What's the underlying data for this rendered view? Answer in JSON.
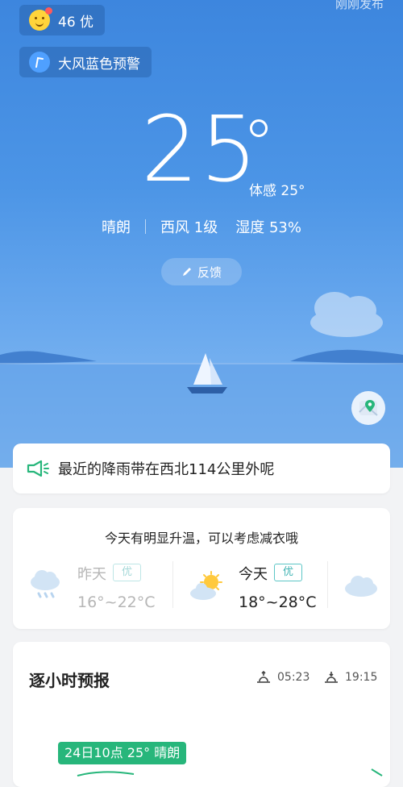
{
  "header": {
    "status_text": "刚刚发布",
    "aqi": {
      "value": "46 优",
      "icon": "aqi-smile-icon"
    },
    "warning": {
      "label": "大风蓝色预警",
      "icon": "wind-warning-icon"
    }
  },
  "current": {
    "temperature": "25",
    "feels_like": "体感 25°",
    "condition": "晴朗",
    "wind": "西风 1级",
    "humidity": "湿度 53%",
    "feedback_label": "反馈"
  },
  "rain_notice": {
    "text": "最近的降雨带在西北114公里外呢",
    "icon": "megaphone-icon"
  },
  "daily": {
    "tip": "今天有明显升温，可以考虑减衣哦",
    "yesterday": {
      "name": "昨天",
      "badge": "优",
      "range": "16°~22°C",
      "icon": "cloud-rain-icon"
    },
    "today": {
      "name": "今天",
      "badge": "优",
      "range": "18°~28°C",
      "icon": "partly-sunny-icon"
    },
    "tomorrow_icon": "cloud-icon"
  },
  "hourly": {
    "title": "逐小时预报",
    "sunrise": "05:23",
    "sunset": "19:15",
    "tag": "24日10点 25° 晴朗"
  },
  "colors": {
    "sky_top": "#3d86de",
    "accent_green": "#27b67b",
    "badge_teal": "#3fb3b3"
  }
}
